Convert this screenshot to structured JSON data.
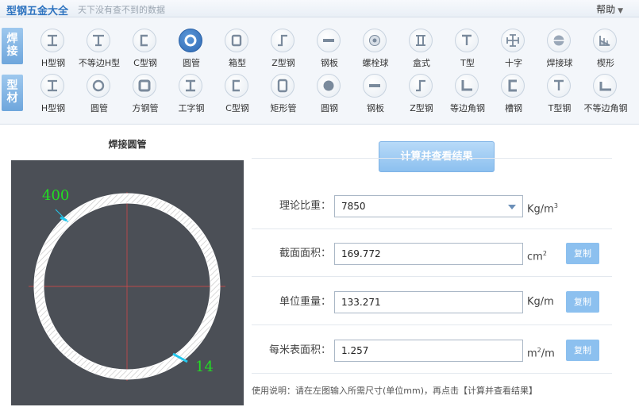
{
  "titlebar": {
    "title": "型钢五金大全",
    "slogan": "天下没有查不到的数据",
    "help": "帮助"
  },
  "categories": {
    "weld": {
      "chars": [
        "焊",
        "接"
      ]
    },
    "profile": {
      "chars": [
        "型",
        "材"
      ]
    }
  },
  "weld_tools": [
    {
      "label": "H型钢",
      "icon": "h-beam-icon"
    },
    {
      "label": "不等边H型",
      "icon": "unequal-h-beam-icon"
    },
    {
      "label": "C型钢",
      "icon": "c-channel-icon"
    },
    {
      "label": "圆管",
      "icon": "round-tube-icon",
      "active": true
    },
    {
      "label": "箱型",
      "icon": "box-section-icon"
    },
    {
      "label": "Z型钢",
      "icon": "z-section-icon"
    },
    {
      "label": "钢板",
      "icon": "steel-plate-icon"
    },
    {
      "label": "螺栓球",
      "icon": "bolt-ball-icon"
    },
    {
      "label": "盒式",
      "icon": "box-type-icon"
    },
    {
      "label": "T型",
      "icon": "t-section-icon"
    },
    {
      "label": "十字",
      "icon": "cross-section-icon"
    },
    {
      "label": "焊接球",
      "icon": "welded-ball-icon"
    },
    {
      "label": "楔形",
      "icon": "wedge-icon"
    }
  ],
  "profile_tools": [
    {
      "label": "H型钢",
      "icon": "h-beam-icon"
    },
    {
      "label": "圆管",
      "icon": "round-tube-icon"
    },
    {
      "label": "方钢管",
      "icon": "square-tube-icon"
    },
    {
      "label": "工字钢",
      "icon": "i-beam-icon"
    },
    {
      "label": "C型钢",
      "icon": "c-channel-icon"
    },
    {
      "label": "矩形管",
      "icon": "rect-tube-icon"
    },
    {
      "label": "圆钢",
      "icon": "round-bar-icon"
    },
    {
      "label": "钢板",
      "icon": "steel-plate-icon"
    },
    {
      "label": "Z型钢",
      "icon": "z-section-icon"
    },
    {
      "label": "等边角钢",
      "icon": "equal-angle-icon"
    },
    {
      "label": "槽钢",
      "icon": "channel-icon"
    },
    {
      "label": "T型钢",
      "icon": "t-section-icon"
    },
    {
      "label": "不等边角钢",
      "icon": "unequal-angle-icon"
    }
  ],
  "drawing": {
    "title": "焊接圆管",
    "diameter_label": "400",
    "thickness_label": "14"
  },
  "form": {
    "calc_button": "计算并查看结果",
    "density": {
      "label": "理论比重：",
      "value": "7850",
      "unit": "Kg/m",
      "unit_sup": "3"
    },
    "area": {
      "label": "截面面积：",
      "value": "169.772",
      "unit": "cm",
      "unit_sup": "2",
      "copy": "复制"
    },
    "weight": {
      "label": "单位重量：",
      "value": "133.271",
      "unit": "Kg/m",
      "copy": "复制"
    },
    "surface": {
      "label": "每米表面积：",
      "value": "1.257",
      "unit_pre": "m",
      "unit_sup": "2",
      "unit_post": "/m",
      "copy": "复制"
    },
    "note": "使用说明：请在左图输入所需尺寸(单位mm)，再点击【计算并查看结果】"
  },
  "colors": {
    "accent": "#2f74c0",
    "button": "#8cc0ef",
    "canvas": "#4b4f56",
    "dim_text": "#22dd22"
  }
}
